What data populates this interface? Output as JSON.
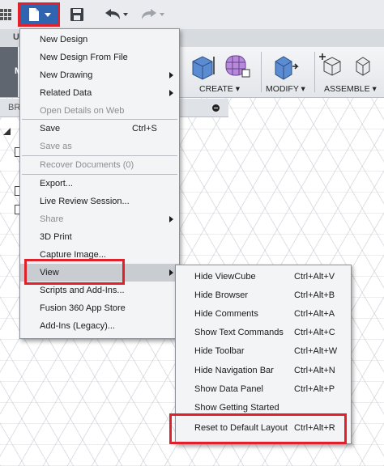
{
  "tab": {
    "letter": "U"
  },
  "ribbon": {
    "left_letter": "M",
    "create_label": "CREATE ▾",
    "modify_label": "MODIFY ▾",
    "assemble_label": "ASSEMBLE ▾"
  },
  "browser": {
    "label": "BR"
  },
  "file_menu": {
    "items": [
      {
        "label": "New Design",
        "shortcut": "",
        "submenu": false,
        "disabled": false
      },
      {
        "label": "New Design From File",
        "shortcut": "",
        "submenu": false,
        "disabled": false
      },
      {
        "label": "New Drawing",
        "shortcut": "",
        "submenu": true,
        "disabled": false
      },
      {
        "label": "Related Data",
        "shortcut": "",
        "submenu": true,
        "disabled": false
      },
      {
        "label": "Open Details on Web",
        "shortcut": "",
        "submenu": false,
        "disabled": true
      },
      {
        "label": "Save",
        "shortcut": "Ctrl+S",
        "submenu": false,
        "disabled": false
      },
      {
        "label": "Save as",
        "shortcut": "",
        "submenu": false,
        "disabled": true
      },
      {
        "label": "Recover Documents (0)",
        "shortcut": "",
        "submenu": false,
        "disabled": true
      },
      {
        "label": "Export...",
        "shortcut": "",
        "submenu": false,
        "disabled": false
      },
      {
        "label": "Live Review Session...",
        "shortcut": "",
        "submenu": false,
        "disabled": false
      },
      {
        "label": "Share",
        "shortcut": "",
        "submenu": true,
        "disabled": true
      },
      {
        "label": "3D Print",
        "shortcut": "",
        "submenu": false,
        "disabled": false
      },
      {
        "label": "Capture Image...",
        "shortcut": "",
        "submenu": false,
        "disabled": false
      },
      {
        "label": "View",
        "shortcut": "",
        "submenu": true,
        "disabled": false
      },
      {
        "label": "Scripts and Add-Ins...",
        "shortcut": "",
        "submenu": false,
        "disabled": false
      },
      {
        "label": "Fusion 360 App Store",
        "shortcut": "",
        "submenu": false,
        "disabled": false
      },
      {
        "label": "Add-Ins (Legacy)...",
        "shortcut": "",
        "submenu": false,
        "disabled": false
      }
    ]
  },
  "view_submenu": {
    "items": [
      {
        "label": "Hide ViewCube",
        "shortcut": "Ctrl+Alt+V"
      },
      {
        "label": "Hide Browser",
        "shortcut": "Ctrl+Alt+B"
      },
      {
        "label": "Hide Comments",
        "shortcut": "Ctrl+Alt+A"
      },
      {
        "label": "Show Text Commands",
        "shortcut": "Ctrl+Alt+C"
      },
      {
        "label": "Hide Toolbar",
        "shortcut": "Ctrl+Alt+W"
      },
      {
        "label": "Hide Navigation Bar",
        "shortcut": "Ctrl+Alt+N"
      },
      {
        "label": "Show Data Panel",
        "shortcut": "Ctrl+Alt+P"
      },
      {
        "label": "Show Getting Started",
        "shortcut": ""
      },
      {
        "label": "Reset to Default Layout",
        "shortcut": "Ctrl+Alt+R"
      }
    ]
  },
  "colors": {
    "highlight": "#e0212b",
    "file_button": "#2f64b0",
    "menu_bg": "#f3f4f6"
  }
}
